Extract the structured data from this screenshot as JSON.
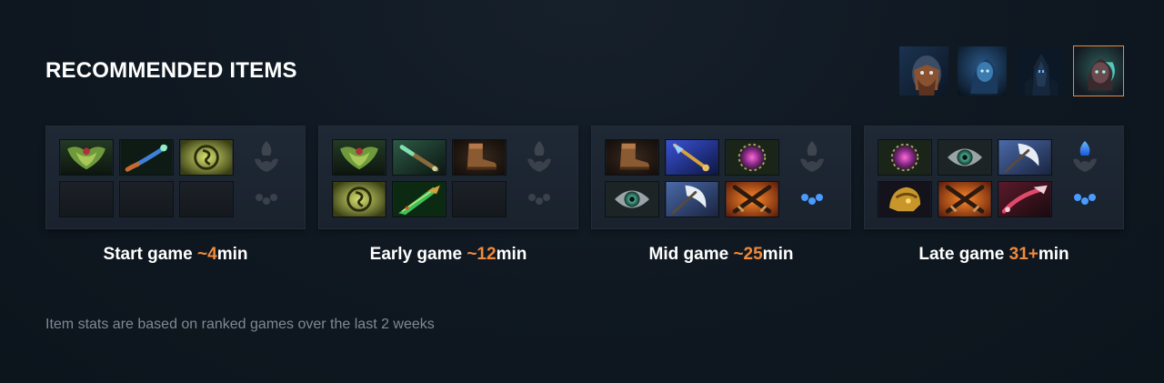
{
  "section": {
    "title": "RECOMMENDED ITEMS",
    "footnote": "Item stats are based on ranked games over the last 2 weeks"
  },
  "heroes": [
    {
      "icon": "hero-portrait-bearded-icon",
      "selected": false
    },
    {
      "icon": "hero-portrait-blue-icon",
      "selected": false
    },
    {
      "icon": "hero-portrait-dark-icon",
      "selected": false
    },
    {
      "icon": "hero-portrait-spectral-icon",
      "selected": true
    }
  ],
  "accent_color": "#f08a3a",
  "builds": [
    {
      "label_prefix": "Start game ",
      "label_time": "~4",
      "label_suffix": "min",
      "items": [
        "green-crest-icon",
        "blue-staff-icon",
        "gold-ring-icon",
        "empty",
        "empty",
        "empty"
      ],
      "neutral": [
        "neutral-dim",
        "neutral-dim"
      ]
    },
    {
      "label_prefix": "Early game ",
      "label_time": "~12",
      "label_suffix": "min",
      "items": [
        "green-crest-icon",
        "green-wand-icon",
        "boots-icon",
        "gold-ring-icon",
        "green-blade-icon",
        "empty"
      ],
      "neutral": [
        "neutral-dim",
        "neutral-dim"
      ]
    },
    {
      "label_prefix": "Mid game ",
      "label_time": "~25",
      "label_suffix": "min",
      "items": [
        "boots-icon",
        "blue-scepter-icon",
        "purple-orb-icon",
        "teal-eye-icon",
        "white-axe-icon",
        "crossed-swords-icon"
      ],
      "neutral": [
        "neutral-dim",
        "neutral-blue"
      ]
    },
    {
      "label_prefix": "Late game ",
      "label_time": "31+",
      "label_suffix": "min",
      "items": [
        "purple-orb-icon",
        "teal-eye-icon",
        "white-axe-icon",
        "gold-helm-icon",
        "crossed-swords-icon",
        "red-whip-icon"
      ],
      "neutral": [
        "neutral-blue",
        "neutral-blue"
      ]
    }
  ]
}
